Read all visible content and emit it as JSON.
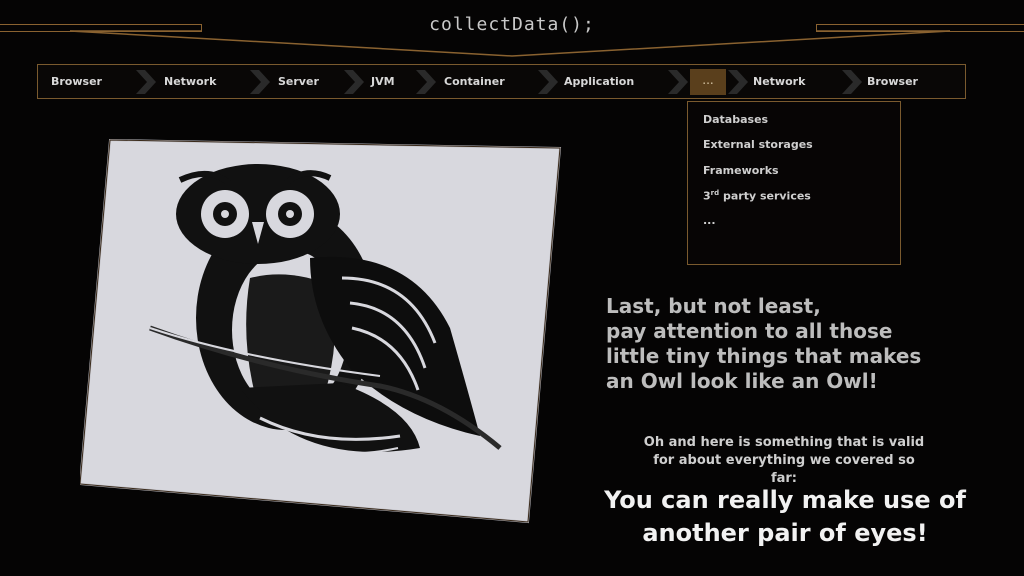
{
  "header": {
    "title": "collectData();"
  },
  "breadcrumb": {
    "items": [
      "Browser",
      "Network",
      "Server",
      "JVM",
      "Container",
      "Application",
      "...",
      "Network",
      "Browser"
    ]
  },
  "dropdown": {
    "items": [
      "Databases",
      "External storages",
      "Frameworks",
      "party services",
      "..."
    ],
    "third_prefix": "3",
    "third_sup": "rd"
  },
  "content": {
    "headline": [
      "Last, but not least,",
      "pay attention to all those",
      "little tiny things that makes",
      "an Owl look like an Owl!"
    ],
    "note": [
      "Oh and here is something that is valid",
      "for about everything we covered so far:"
    ],
    "callout": [
      "You can really make use of",
      "another pair of eyes!"
    ]
  },
  "colors": {
    "accent": "#8a6230",
    "active_crumb": "#5a3f1c",
    "background": "#050404"
  },
  "icons": {
    "separator": "chevron-right-icon"
  }
}
